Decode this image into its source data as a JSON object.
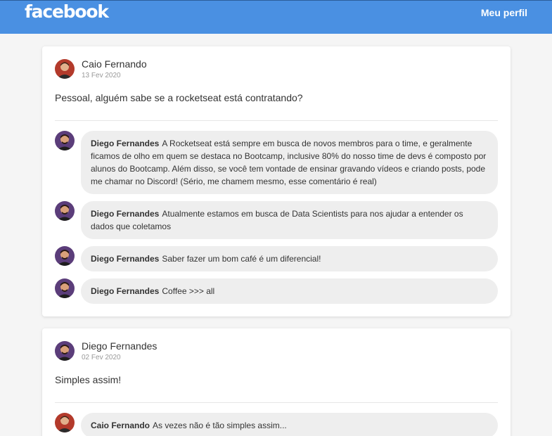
{
  "header": {
    "logo": "facebook",
    "profile_link": "Meu perfil"
  },
  "posts": [
    {
      "author": "Caio Fernando",
      "date": "13 Fev 2020",
      "text": "Pessoal, alguém sabe se a rocketseat está contratando?",
      "avatar": "caio",
      "comments": [
        {
          "author": "Diego Fernandes",
          "avatar": "diego",
          "text": "A Rocketseat está sempre em busca de novos membros para o time, e geralmente ficamos de olho em quem se destaca no Bootcamp, inclusive 80% do nosso time de devs é composto por alunos do Bootcamp. Além disso, se você tem vontade de ensinar gravando vídeos e criando posts, pode me chamar no Discord! (Sério, me chamem mesmo, esse comentário é real)"
        },
        {
          "author": "Diego Fernandes",
          "avatar": "diego",
          "text": "Atualmente estamos em busca de Data Scientists para nos ajudar a entender os dados que coletamos"
        },
        {
          "author": "Diego Fernandes",
          "avatar": "diego",
          "text": "Saber fazer um bom café é um diferencial!"
        },
        {
          "author": "Diego Fernandes",
          "avatar": "diego",
          "text": "Coffee >>> all"
        }
      ]
    },
    {
      "author": "Diego Fernandes",
      "date": "02 Fev 2020",
      "text": "Simples assim!",
      "avatar": "diego",
      "comments": [
        {
          "author": "Caio Fernando",
          "avatar": "caio",
          "text": "As vezes não é tão simples assim..."
        }
      ]
    }
  ],
  "colors": {
    "header": "#4a90e2",
    "bubble": "#eeeeee",
    "caio_avatar_bg": "#b33a2b",
    "diego_avatar_bg": "#5b3d7a"
  }
}
